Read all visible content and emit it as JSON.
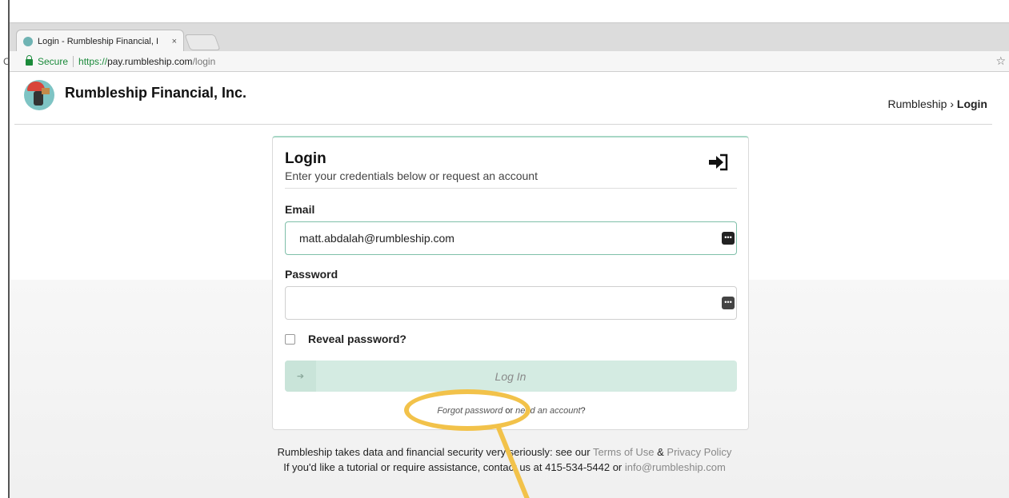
{
  "browser": {
    "tab_title": "Login - Rumbleship Financial, I",
    "tab_close": "×",
    "secure_label": "Secure",
    "url_scheme": "https://",
    "url_host": "pay.rumbleship.com",
    "url_path": "/login",
    "star_glyph": "☆",
    "reload_glyph": "C"
  },
  "header": {
    "brand": "Rumbleship Financial, Inc.",
    "breadcrumb_root": "Rumbleship",
    "breadcrumb_sep": "›",
    "breadcrumb_current": "Login"
  },
  "login": {
    "title": "Login",
    "subtitle": "Enter your credentials below or request an account",
    "email_label": "Email",
    "email_value": "matt.abdalah@rumbleship.com",
    "password_label": "Password",
    "password_value": "",
    "reveal_label": "Reveal password?",
    "submit_label": "Log In",
    "forgot_label": "Forgot password",
    "or_text": " or ",
    "need_account_label": "need an account",
    "help_suffix": "?"
  },
  "footer": {
    "line1_text": "Rumbleship takes data and financial security very seriously: see our ",
    "terms_label": "Terms of Use",
    "amp": " & ",
    "privacy_label": "Privacy Policy",
    "line2_text": "If you'd like a tutorial or require assistance, contact us at 415-534-5442 or ",
    "email_link": "info@rumbleship.com"
  },
  "colors": {
    "accent_green": "#a7d7c5",
    "button_bg": "#d4ebe2",
    "annotation_yellow": "#f2c24a",
    "secure_green": "#1a8a3a"
  },
  "icons": [
    "favicon-icon",
    "lock-icon",
    "star-icon",
    "logo-icon",
    "login-icon",
    "password-manager-icon",
    "checkbox-icon",
    "sign-in-icon"
  ]
}
